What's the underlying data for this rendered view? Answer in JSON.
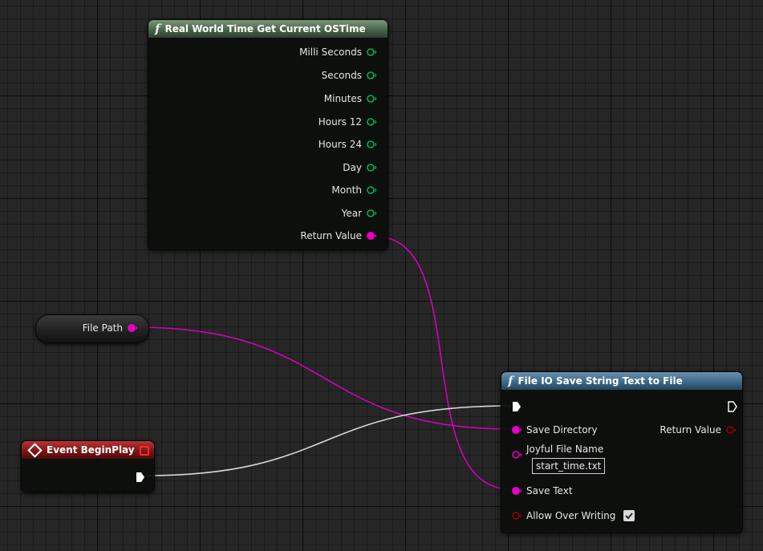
{
  "nodes": {
    "time_node": {
      "title": "Real World Time  Get Current OSTime",
      "header_color": "#5d7a5a",
      "outputs": [
        "Milli Seconds",
        "Seconds",
        "Minutes",
        "Hours 12",
        "Hours 24",
        "Day",
        "Month",
        "Year",
        "Return Value"
      ]
    },
    "file_path_var": {
      "label": "File Path"
    },
    "begin_play": {
      "title": "Event BeginPlay",
      "header_color": "#8a1a1a"
    },
    "save_node": {
      "title": "File IO  Save String Text to File",
      "header_color": "#4d6f88",
      "inputs": {
        "save_directory": "Save Directory",
        "file_name": "Joyful File Name",
        "file_name_value": "start_time.txt",
        "save_text": "Save Text",
        "allow_over_writing": "Allow Over Writing",
        "allow_over_writing_checked": true
      },
      "outputs": {
        "return_value": "Return Value"
      }
    }
  },
  "colors": {
    "string_pin": "#e800c4",
    "struct_pin": "#00b35a",
    "bool_pin": "#960000",
    "exec_pin": "#ffffff",
    "string_wire": "#d400b8",
    "exec_wire": "#d8d8d8"
  },
  "icons": {
    "function": "f",
    "event": "diamond-icon",
    "delegate": "red-square-icon"
  }
}
